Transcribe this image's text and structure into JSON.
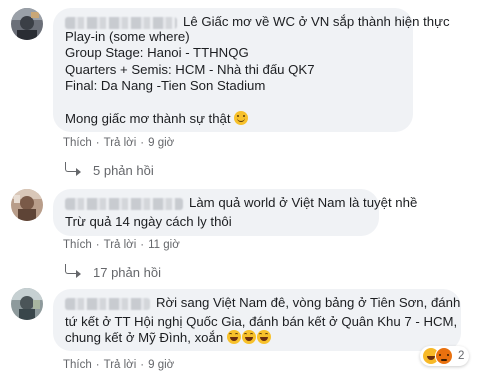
{
  "comments": [
    {
      "lines": [
        "Lê Giấc mơ về WC ở VN sắp thành hiện thực",
        "Play-in (some where)",
        "Group Stage: Hanoi - TTHNQG",
        "Quarters + Semis: HCM - Nhà thi đấu QK7",
        "Final: Da Nang -Tien Son Stadium",
        "Mong giấc mơ thành sự thật"
      ],
      "actions": {
        "like": "Thích",
        "reply": "Trả lời",
        "time": "9 giờ"
      },
      "replies": "5 phản hồi",
      "emoji": "smile"
    },
    {
      "lines": [
        "Làm quả world ở Việt Nam là tuyệt nhề",
        "Trừ quả 14 ngày cách ly thôi"
      ],
      "actions": {
        "like": "Thích",
        "reply": "Trả lời",
        "time": "11 giờ"
      },
      "replies": "17 phản hồi"
    },
    {
      "lines": [
        "Rời sang Việt Nam đê, vòng bảng ở Tiên Sơn, đánh",
        "tứ kết ở TT Hội nghị Quốc Gia, đánh bán kết ở Quân Khu 7 - HCM,",
        "chung kết ở Mỹ Đình, xoắn"
      ],
      "actions": {
        "like": "Thích",
        "reply": "Trả lời",
        "time": "9 giờ"
      },
      "reactions": {
        "count": "2",
        "icons": [
          "haha-icon",
          "angry-icon"
        ]
      },
      "emoji": "laugh"
    }
  ],
  "separator": "·"
}
